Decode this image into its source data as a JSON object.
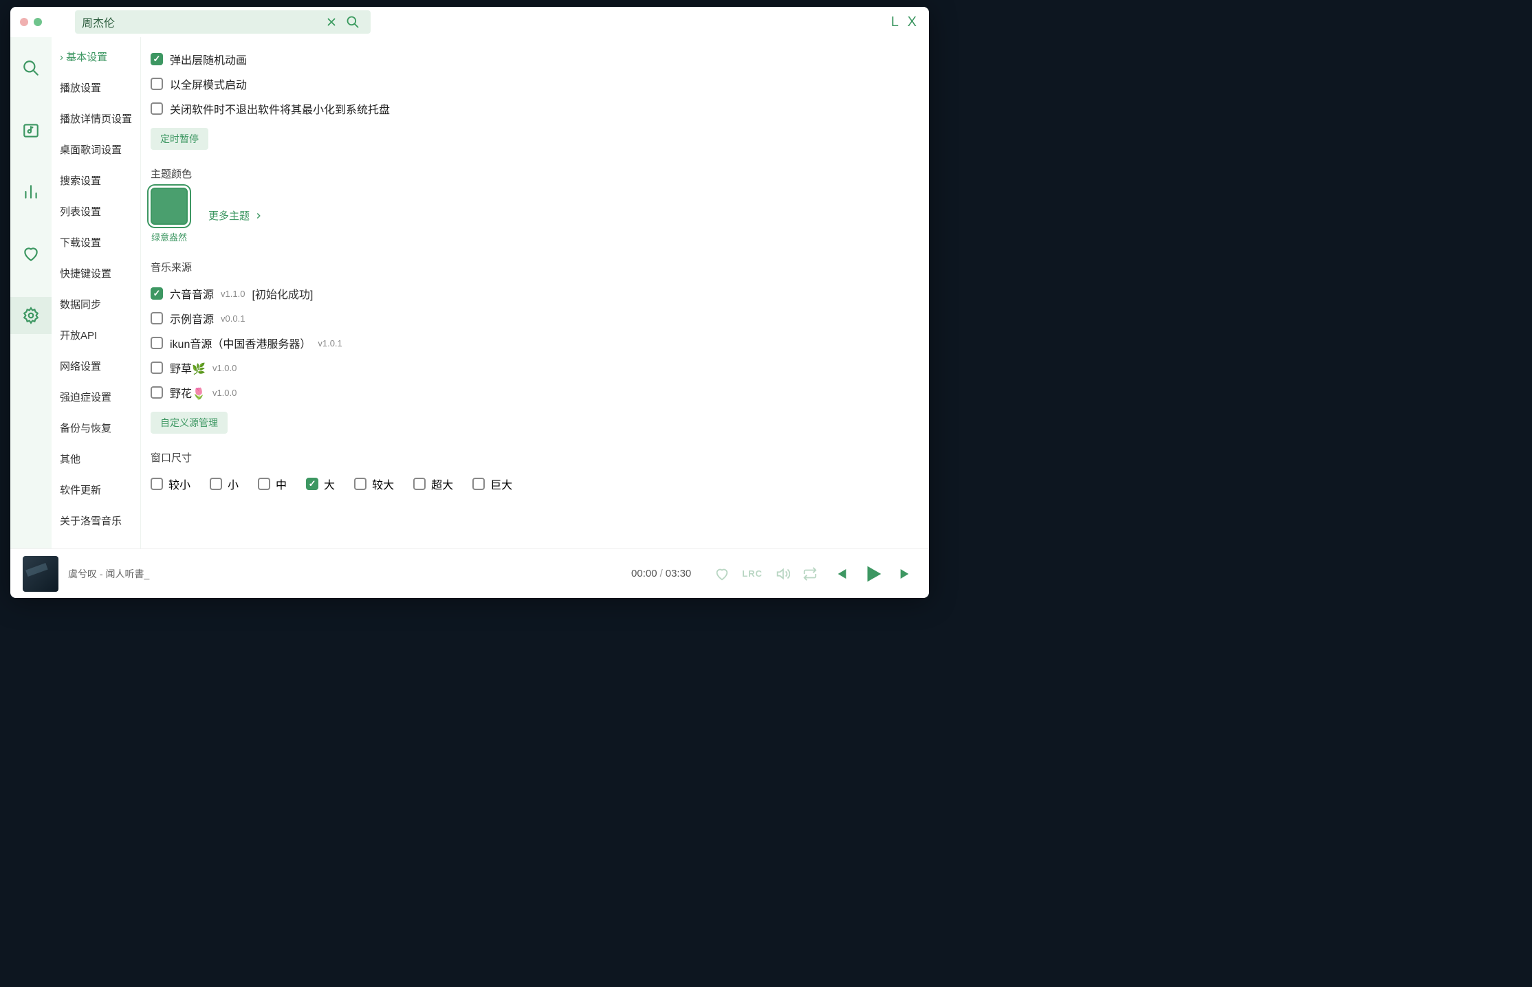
{
  "search": {
    "value": "周杰伦"
  },
  "logo": "L X",
  "sidebar": [
    "基本设置",
    "播放设置",
    "播放详情页设置",
    "桌面歌词设置",
    "搜索设置",
    "列表设置",
    "下载设置",
    "快捷键设置",
    "数据同步",
    "开放API",
    "网络设置",
    "强迫症设置",
    "备份与恢复",
    "其他",
    "软件更新",
    "关于洛雪音乐"
  ],
  "sidebarActive": 0,
  "general": {
    "checks": [
      {
        "label": "弹出层随机动画",
        "checked": true
      },
      {
        "label": "以全屏模式启动",
        "checked": false
      },
      {
        "label": "关闭软件时不退出软件将其最小化到系统托盘",
        "checked": false
      }
    ],
    "timedPause": "定时暂停"
  },
  "theme": {
    "sectionLabel": "主题颜色",
    "swatchLabel": "绿意盎然",
    "moreLabel": "更多主题"
  },
  "sources": {
    "sectionLabel": "音乐来源",
    "items": [
      {
        "name": "六音音源",
        "version": "v1.1.0",
        "status": "[初始化成功]",
        "checked": true
      },
      {
        "name": "示例音源",
        "version": "v0.0.1",
        "status": "",
        "checked": false
      },
      {
        "name": "ikun音源（中国香港服务器）",
        "version": "v1.0.1",
        "status": "",
        "checked": false
      },
      {
        "name": "野草🌿",
        "version": "v1.0.0",
        "status": "",
        "checked": false
      },
      {
        "name": "野花🌷",
        "version": "v1.0.0",
        "status": "",
        "checked": false
      }
    ],
    "manageLabel": "自定义源管理"
  },
  "windowSize": {
    "sectionLabel": "窗口尺寸",
    "options": [
      "较小",
      "小",
      "中",
      "大",
      "较大",
      "超大",
      "巨大"
    ],
    "selected": "大"
  },
  "player": {
    "track": "虞兮叹 - 闻人听書_",
    "current": "00:00",
    "total": "03:30"
  }
}
